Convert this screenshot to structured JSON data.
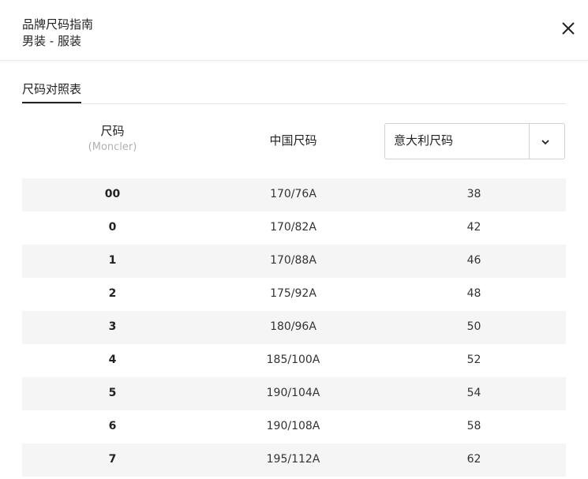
{
  "header": {
    "title": "品牌尺码指南",
    "subtitle": "男装 - 服装",
    "close_icon": "close-icon"
  },
  "tabs": [
    {
      "label": "尺码对照表",
      "active": true
    }
  ],
  "columns": {
    "brand_label": "尺码",
    "brand_sub": "(Moncler)",
    "china_label": "中国尺码",
    "region_select": {
      "value": "意大利尺码",
      "icon": "chevron-down-icon"
    }
  },
  "rows": [
    {
      "brand": "00",
      "china": "170/76A",
      "region": "38"
    },
    {
      "brand": "0",
      "china": "170/82A",
      "region": "42"
    },
    {
      "brand": "1",
      "china": "170/88A",
      "region": "46"
    },
    {
      "brand": "2",
      "china": "175/92A",
      "region": "48"
    },
    {
      "brand": "3",
      "china": "180/96A",
      "region": "50"
    },
    {
      "brand": "4",
      "china": "185/100A",
      "region": "52"
    },
    {
      "brand": "5",
      "china": "190/104A",
      "region": "54"
    },
    {
      "brand": "6",
      "china": "190/108A",
      "region": "58"
    },
    {
      "brand": "7",
      "china": "195/112A",
      "region": "62"
    }
  ],
  "colors": {
    "row_shade": "#f5f5f5",
    "text": "#222222",
    "muted": "#b0b0b0",
    "border": "#d2d2d2"
  }
}
